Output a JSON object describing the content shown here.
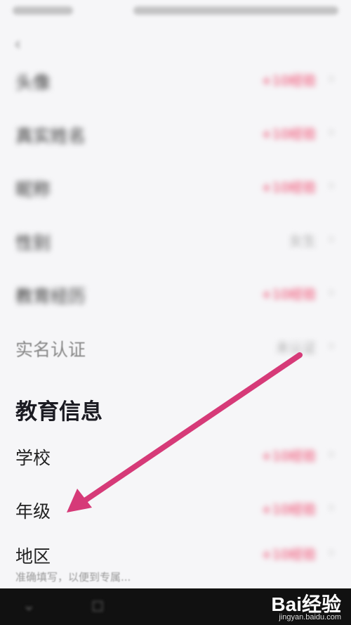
{
  "rows": [
    {
      "label": "头像",
      "value": "+10经验",
      "tone": "red"
    },
    {
      "label": "真实姓名",
      "value": "+10经验",
      "tone": "red"
    },
    {
      "label": "昵称",
      "value": "+10经验",
      "tone": "red"
    },
    {
      "label": "性别",
      "value": "女生",
      "tone": "gray"
    },
    {
      "label": "教育经历",
      "value": "+10经验",
      "tone": "red"
    },
    {
      "label": "实名认证",
      "value": "未认证",
      "tone": "gray"
    }
  ],
  "education": {
    "title": "教育信息",
    "rows": [
      {
        "label": "学校",
        "value": "+10经验"
      },
      {
        "label": "年级",
        "value": "+10经验"
      },
      {
        "label": "地区",
        "value": "+10经验"
      }
    ],
    "hint": "准确填写，以便到专属..."
  },
  "watermark": {
    "text": "Bai经验",
    "url": "jingyan.baidu.com"
  },
  "colors": {
    "accent": "#ef3c63",
    "annotation": "#d63a78"
  },
  "icons": {
    "back": "‹",
    "chevron": "›"
  }
}
